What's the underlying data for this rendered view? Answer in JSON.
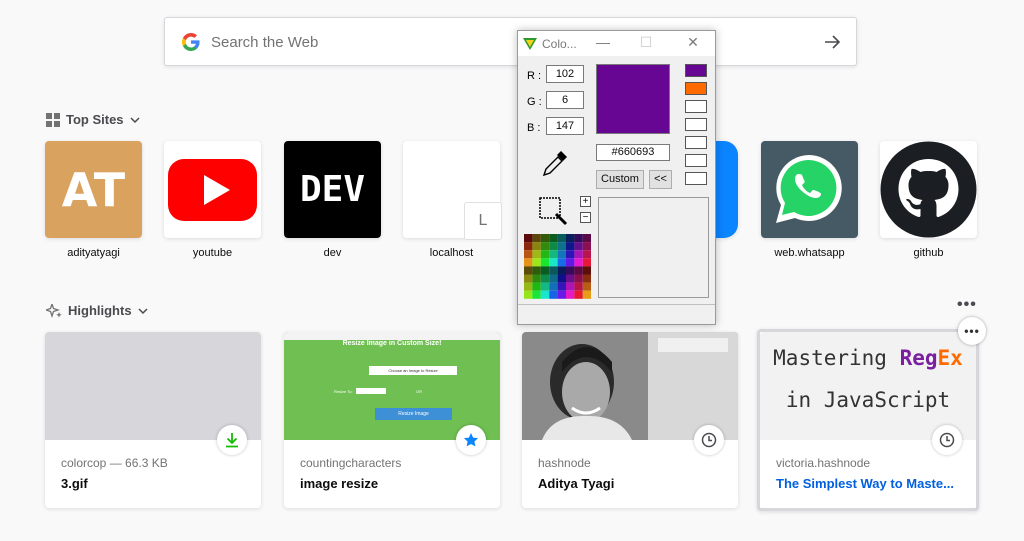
{
  "search": {
    "placeholder": "Search the Web"
  },
  "top_sites": {
    "title": "Top Sites",
    "items": [
      {
        "label": "adityatyagi",
        "tile_text": "AT"
      },
      {
        "label": "youtube"
      },
      {
        "label": "dev",
        "tile_text": "DEV"
      },
      {
        "label": "localhost",
        "tile_text": "L"
      },
      {
        "label": ""
      },
      {
        "label": ""
      },
      {
        "label": "web.whatsapp"
      },
      {
        "label": "github"
      }
    ]
  },
  "highlights": {
    "title": "Highlights",
    "cards": [
      {
        "source": "colorcop — 66.3 KB",
        "title": "3.gif",
        "badge": "download-icon"
      },
      {
        "source": "countingcharacters",
        "title": "image resize",
        "badge": "bookmark-star-icon",
        "thumb_heading": "Resize Image in Custom Size!",
        "thumb_button": "Resize Image",
        "thumb_choose": "Choose an Image to Resize",
        "thumb_label": "Resize To:",
        "thumb_or": "OR"
      },
      {
        "source": "hashnode",
        "title": "Aditya Tyagi",
        "badge": "clock-icon"
      },
      {
        "source": "victoria.hashnode",
        "title": "The Simplest Way to Maste...",
        "badge": "clock-icon",
        "thumb_line1_a": "Mastering ",
        "thumb_line1_b": "Reg",
        "thumb_line1_c": "Ex",
        "thumb_line2": "in JavaScript"
      }
    ]
  },
  "colorcop": {
    "title": "Colo...",
    "r_label": "R :",
    "g_label": "G :",
    "b_label": "B :",
    "r": "102",
    "g": "6",
    "b": "147",
    "hex": "#660693",
    "custom_button": "Custom",
    "back_button": "<<",
    "current_color": "#660693",
    "history_colors": [
      "#660693",
      "#ff6a00",
      "#ffffff",
      "#ffffff",
      "#ffffff",
      "#ffffff",
      "#ffffff"
    ]
  },
  "colors": {
    "accent": "#0060df",
    "background": "#f9f9fa",
    "download_green": "#12bc00"
  }
}
